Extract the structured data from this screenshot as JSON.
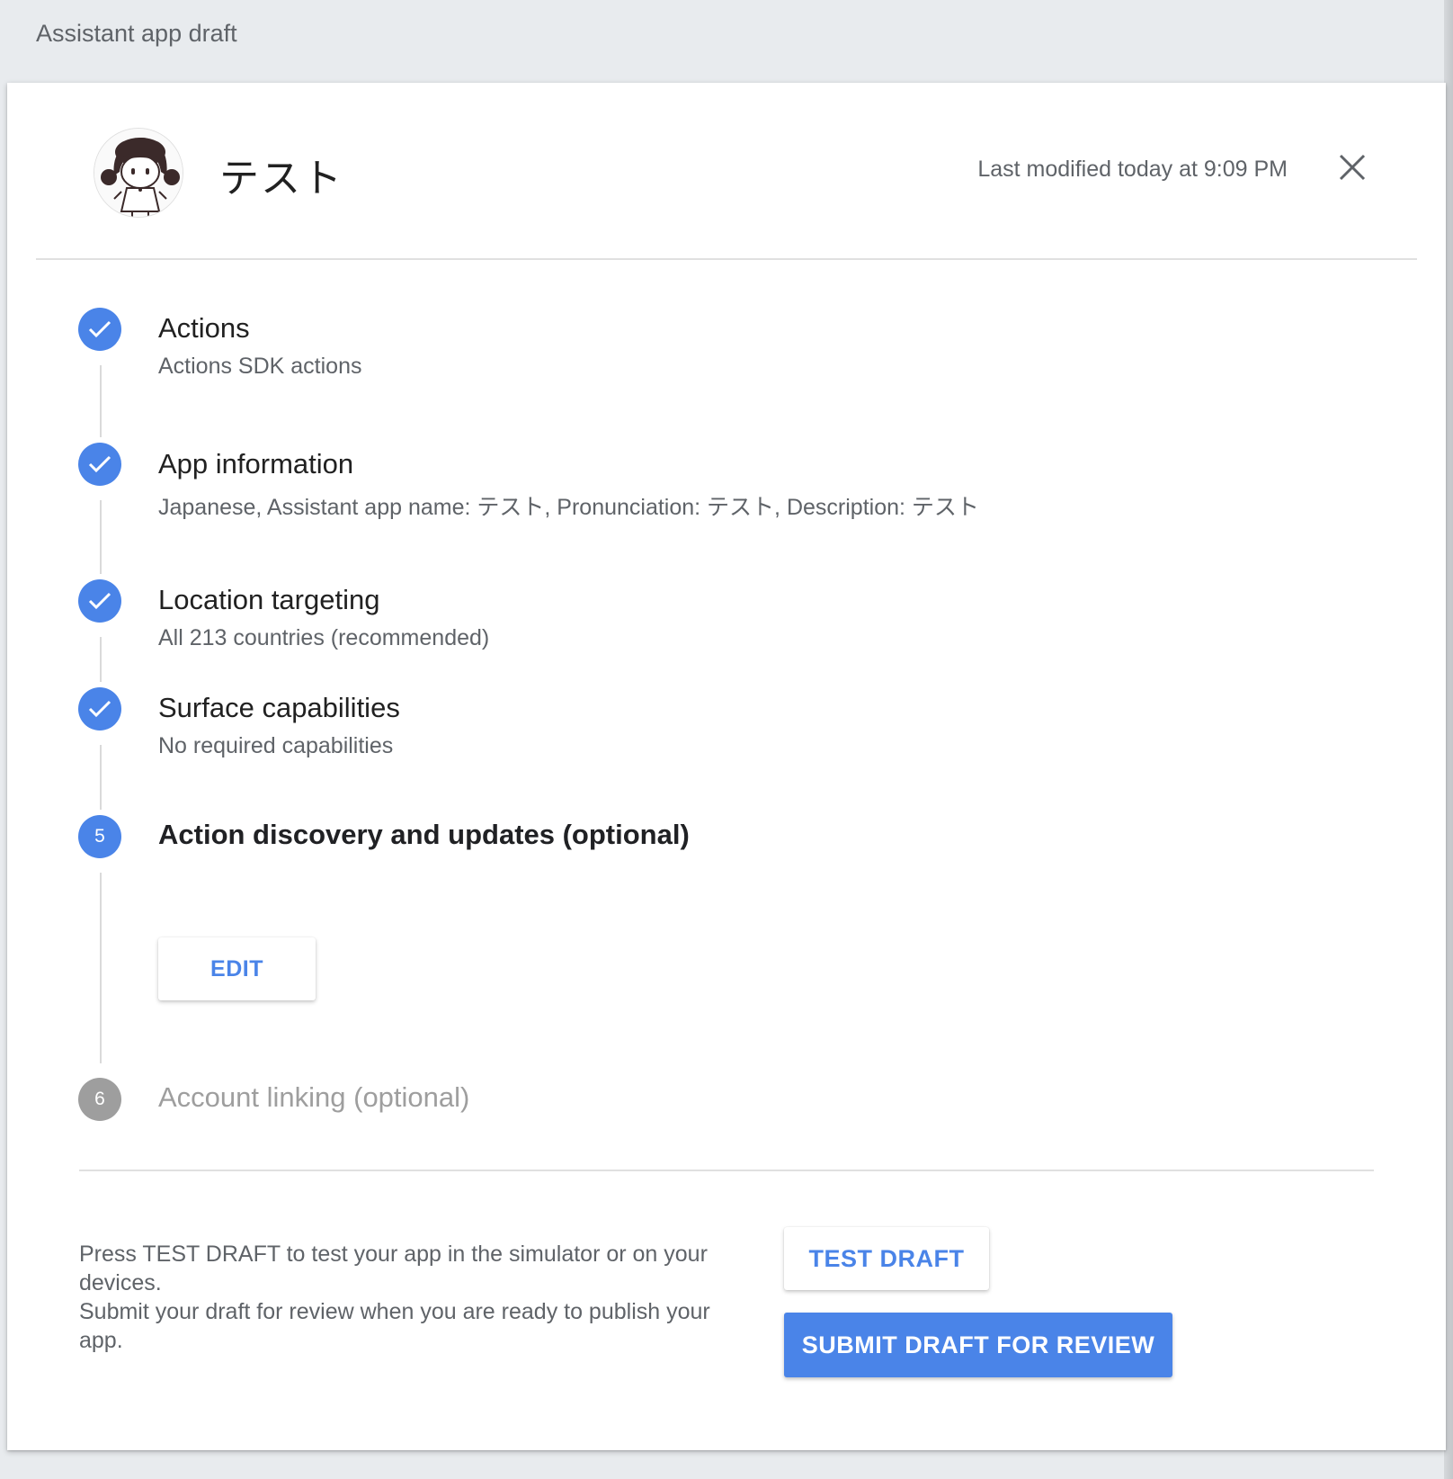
{
  "page": {
    "title": "Assistant app draft"
  },
  "header": {
    "app_name": "テスト",
    "last_modified": "Last modified today at 9:09 PM",
    "avatar_icon": "girl-character-avatar",
    "close_icon": "close-icon"
  },
  "steps": [
    {
      "status": "done",
      "title": "Actions",
      "subtitle": "Actions SDK actions"
    },
    {
      "status": "done",
      "title": "App information",
      "subtitle": "Japanese, Assistant app name: テスト, Pronunciation: テスト, Description: テスト"
    },
    {
      "status": "done",
      "title": "Location targeting",
      "subtitle": "All 213 countries (recommended)"
    },
    {
      "status": "done",
      "title": "Surface capabilities",
      "subtitle": "No required capabilities"
    },
    {
      "status": "active",
      "number": "5",
      "title": "Action discovery and updates (optional)",
      "button": "EDIT"
    },
    {
      "status": "pending",
      "number": "6",
      "title": "Account linking (optional)"
    }
  ],
  "footer": {
    "line1": "Press TEST DRAFT to test your app in the simulator or on your devices.",
    "line2": "Submit your draft for review when you are ready to publish your app.",
    "test_button": "TEST DRAFT",
    "submit_button": "SUBMIT DRAFT FOR REVIEW"
  },
  "colors": {
    "accent": "#4a84e8",
    "pending": "#9e9e9e",
    "background": "#e8ebee"
  }
}
